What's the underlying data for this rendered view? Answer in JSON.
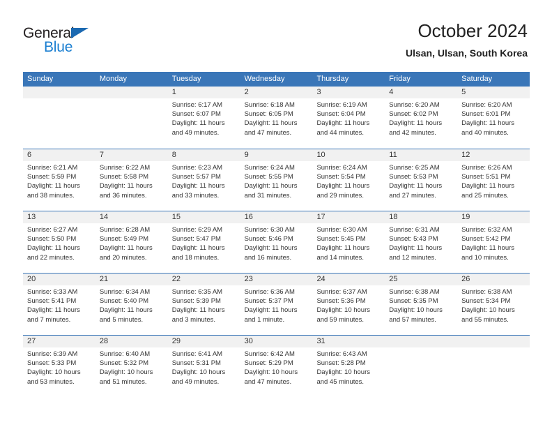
{
  "brand": {
    "name_top": "General",
    "name_bottom": "Blue"
  },
  "header": {
    "month_title": "October 2024",
    "location": "Ulsan, Ulsan, South Korea"
  },
  "colors": {
    "header_blue": "#3a76b8",
    "logo_blue": "#1b7fd1",
    "day_number_band": "#f1f1f1",
    "text": "#333333"
  },
  "weekdays": [
    "Sunday",
    "Monday",
    "Tuesday",
    "Wednesday",
    "Thursday",
    "Friday",
    "Saturday"
  ],
  "weeks": [
    [
      {
        "date": "",
        "sunrise": "",
        "sunset": "",
        "daylight_line1": "",
        "daylight_line2": ""
      },
      {
        "date": "",
        "sunrise": "",
        "sunset": "",
        "daylight_line1": "",
        "daylight_line2": ""
      },
      {
        "date": "1",
        "sunrise": "Sunrise: 6:17 AM",
        "sunset": "Sunset: 6:07 PM",
        "daylight_line1": "Daylight: 11 hours",
        "daylight_line2": "and 49 minutes."
      },
      {
        "date": "2",
        "sunrise": "Sunrise: 6:18 AM",
        "sunset": "Sunset: 6:05 PM",
        "daylight_line1": "Daylight: 11 hours",
        "daylight_line2": "and 47 minutes."
      },
      {
        "date": "3",
        "sunrise": "Sunrise: 6:19 AM",
        "sunset": "Sunset: 6:04 PM",
        "daylight_line1": "Daylight: 11 hours",
        "daylight_line2": "and 44 minutes."
      },
      {
        "date": "4",
        "sunrise": "Sunrise: 6:20 AM",
        "sunset": "Sunset: 6:02 PM",
        "daylight_line1": "Daylight: 11 hours",
        "daylight_line2": "and 42 minutes."
      },
      {
        "date": "5",
        "sunrise": "Sunrise: 6:20 AM",
        "sunset": "Sunset: 6:01 PM",
        "daylight_line1": "Daylight: 11 hours",
        "daylight_line2": "and 40 minutes."
      }
    ],
    [
      {
        "date": "6",
        "sunrise": "Sunrise: 6:21 AM",
        "sunset": "Sunset: 5:59 PM",
        "daylight_line1": "Daylight: 11 hours",
        "daylight_line2": "and 38 minutes."
      },
      {
        "date": "7",
        "sunrise": "Sunrise: 6:22 AM",
        "sunset": "Sunset: 5:58 PM",
        "daylight_line1": "Daylight: 11 hours",
        "daylight_line2": "and 36 minutes."
      },
      {
        "date": "8",
        "sunrise": "Sunrise: 6:23 AM",
        "sunset": "Sunset: 5:57 PM",
        "daylight_line1": "Daylight: 11 hours",
        "daylight_line2": "and 33 minutes."
      },
      {
        "date": "9",
        "sunrise": "Sunrise: 6:24 AM",
        "sunset": "Sunset: 5:55 PM",
        "daylight_line1": "Daylight: 11 hours",
        "daylight_line2": "and 31 minutes."
      },
      {
        "date": "10",
        "sunrise": "Sunrise: 6:24 AM",
        "sunset": "Sunset: 5:54 PM",
        "daylight_line1": "Daylight: 11 hours",
        "daylight_line2": "and 29 minutes."
      },
      {
        "date": "11",
        "sunrise": "Sunrise: 6:25 AM",
        "sunset": "Sunset: 5:53 PM",
        "daylight_line1": "Daylight: 11 hours",
        "daylight_line2": "and 27 minutes."
      },
      {
        "date": "12",
        "sunrise": "Sunrise: 6:26 AM",
        "sunset": "Sunset: 5:51 PM",
        "daylight_line1": "Daylight: 11 hours",
        "daylight_line2": "and 25 minutes."
      }
    ],
    [
      {
        "date": "13",
        "sunrise": "Sunrise: 6:27 AM",
        "sunset": "Sunset: 5:50 PM",
        "daylight_line1": "Daylight: 11 hours",
        "daylight_line2": "and 22 minutes."
      },
      {
        "date": "14",
        "sunrise": "Sunrise: 6:28 AM",
        "sunset": "Sunset: 5:49 PM",
        "daylight_line1": "Daylight: 11 hours",
        "daylight_line2": "and 20 minutes."
      },
      {
        "date": "15",
        "sunrise": "Sunrise: 6:29 AM",
        "sunset": "Sunset: 5:47 PM",
        "daylight_line1": "Daylight: 11 hours",
        "daylight_line2": "and 18 minutes."
      },
      {
        "date": "16",
        "sunrise": "Sunrise: 6:30 AM",
        "sunset": "Sunset: 5:46 PM",
        "daylight_line1": "Daylight: 11 hours",
        "daylight_line2": "and 16 minutes."
      },
      {
        "date": "17",
        "sunrise": "Sunrise: 6:30 AM",
        "sunset": "Sunset: 5:45 PM",
        "daylight_line1": "Daylight: 11 hours",
        "daylight_line2": "and 14 minutes."
      },
      {
        "date": "18",
        "sunrise": "Sunrise: 6:31 AM",
        "sunset": "Sunset: 5:43 PM",
        "daylight_line1": "Daylight: 11 hours",
        "daylight_line2": "and 12 minutes."
      },
      {
        "date": "19",
        "sunrise": "Sunrise: 6:32 AM",
        "sunset": "Sunset: 5:42 PM",
        "daylight_line1": "Daylight: 11 hours",
        "daylight_line2": "and 10 minutes."
      }
    ],
    [
      {
        "date": "20",
        "sunrise": "Sunrise: 6:33 AM",
        "sunset": "Sunset: 5:41 PM",
        "daylight_line1": "Daylight: 11 hours",
        "daylight_line2": "and 7 minutes."
      },
      {
        "date": "21",
        "sunrise": "Sunrise: 6:34 AM",
        "sunset": "Sunset: 5:40 PM",
        "daylight_line1": "Daylight: 11 hours",
        "daylight_line2": "and 5 minutes."
      },
      {
        "date": "22",
        "sunrise": "Sunrise: 6:35 AM",
        "sunset": "Sunset: 5:39 PM",
        "daylight_line1": "Daylight: 11 hours",
        "daylight_line2": "and 3 minutes."
      },
      {
        "date": "23",
        "sunrise": "Sunrise: 6:36 AM",
        "sunset": "Sunset: 5:37 PM",
        "daylight_line1": "Daylight: 11 hours",
        "daylight_line2": "and 1 minute."
      },
      {
        "date": "24",
        "sunrise": "Sunrise: 6:37 AM",
        "sunset": "Sunset: 5:36 PM",
        "daylight_line1": "Daylight: 10 hours",
        "daylight_line2": "and 59 minutes."
      },
      {
        "date": "25",
        "sunrise": "Sunrise: 6:38 AM",
        "sunset": "Sunset: 5:35 PM",
        "daylight_line1": "Daylight: 10 hours",
        "daylight_line2": "and 57 minutes."
      },
      {
        "date": "26",
        "sunrise": "Sunrise: 6:38 AM",
        "sunset": "Sunset: 5:34 PM",
        "daylight_line1": "Daylight: 10 hours",
        "daylight_line2": "and 55 minutes."
      }
    ],
    [
      {
        "date": "27",
        "sunrise": "Sunrise: 6:39 AM",
        "sunset": "Sunset: 5:33 PM",
        "daylight_line1": "Daylight: 10 hours",
        "daylight_line2": "and 53 minutes."
      },
      {
        "date": "28",
        "sunrise": "Sunrise: 6:40 AM",
        "sunset": "Sunset: 5:32 PM",
        "daylight_line1": "Daylight: 10 hours",
        "daylight_line2": "and 51 minutes."
      },
      {
        "date": "29",
        "sunrise": "Sunrise: 6:41 AM",
        "sunset": "Sunset: 5:31 PM",
        "daylight_line1": "Daylight: 10 hours",
        "daylight_line2": "and 49 minutes."
      },
      {
        "date": "30",
        "sunrise": "Sunrise: 6:42 AM",
        "sunset": "Sunset: 5:29 PM",
        "daylight_line1": "Daylight: 10 hours",
        "daylight_line2": "and 47 minutes."
      },
      {
        "date": "31",
        "sunrise": "Sunrise: 6:43 AM",
        "sunset": "Sunset: 5:28 PM",
        "daylight_line1": "Daylight: 10 hours",
        "daylight_line2": "and 45 minutes."
      },
      {
        "date": "",
        "sunrise": "",
        "sunset": "",
        "daylight_line1": "",
        "daylight_line2": ""
      },
      {
        "date": "",
        "sunrise": "",
        "sunset": "",
        "daylight_line1": "",
        "daylight_line2": ""
      }
    ]
  ]
}
